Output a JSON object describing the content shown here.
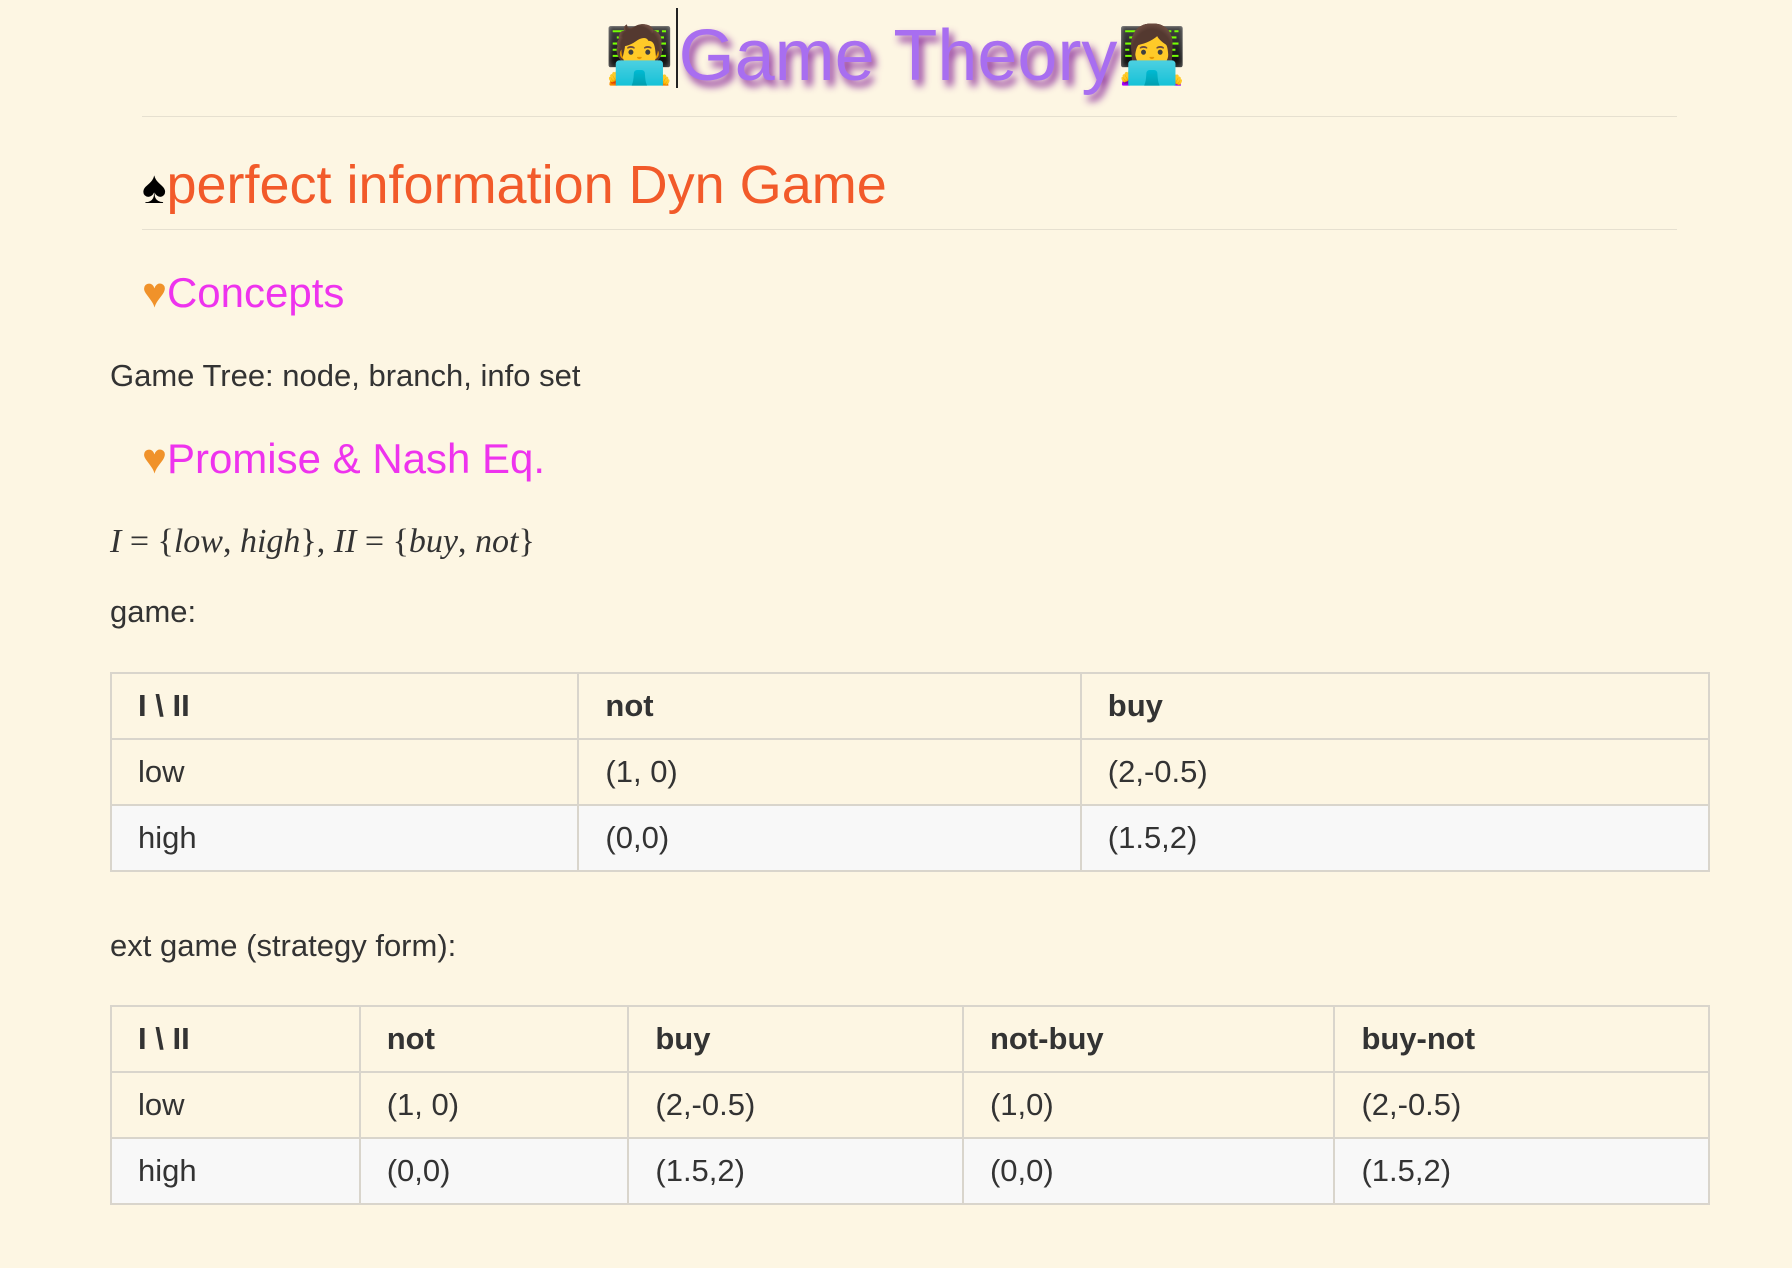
{
  "title": {
    "left_emoji": "🧑‍💻",
    "text": "Game Theory",
    "right_emoji": "👩‍💻"
  },
  "section": {
    "symbol": "♠",
    "heading": "perfect information Dyn Game"
  },
  "concepts": {
    "symbol": "♥",
    "heading": "Concepts",
    "text": "Game Tree: node, branch, info set"
  },
  "promise": {
    "symbol": "♥",
    "heading": "Promise & Nash Eq.",
    "math": {
      "lhs1": "I",
      "set1_a": "low",
      "set1_b": "high",
      "lhs2": "II",
      "set2_a": "buy",
      "set2_b": "not"
    },
    "game_label": "game:"
  },
  "game_table": {
    "headers": [
      "I \\ II",
      "not",
      "buy"
    ],
    "rows": [
      [
        "low",
        "(1, 0)",
        "(2,-0.5)"
      ],
      [
        "high",
        "(0,0)",
        "(1.5,2)"
      ]
    ]
  },
  "ext_label": "ext game (strategy form):",
  "ext_table": {
    "headers": [
      "I \\ II",
      "not",
      "buy",
      "not-buy",
      "buy-not"
    ],
    "rows": [
      [
        "low",
        "(1, 0)",
        "(2,-0.5)",
        "(1,0)",
        "(2,-0.5)"
      ],
      [
        "high",
        "(0,0)",
        "(1.5,2)",
        "(0,0)",
        "(1.5,2)"
      ]
    ]
  }
}
